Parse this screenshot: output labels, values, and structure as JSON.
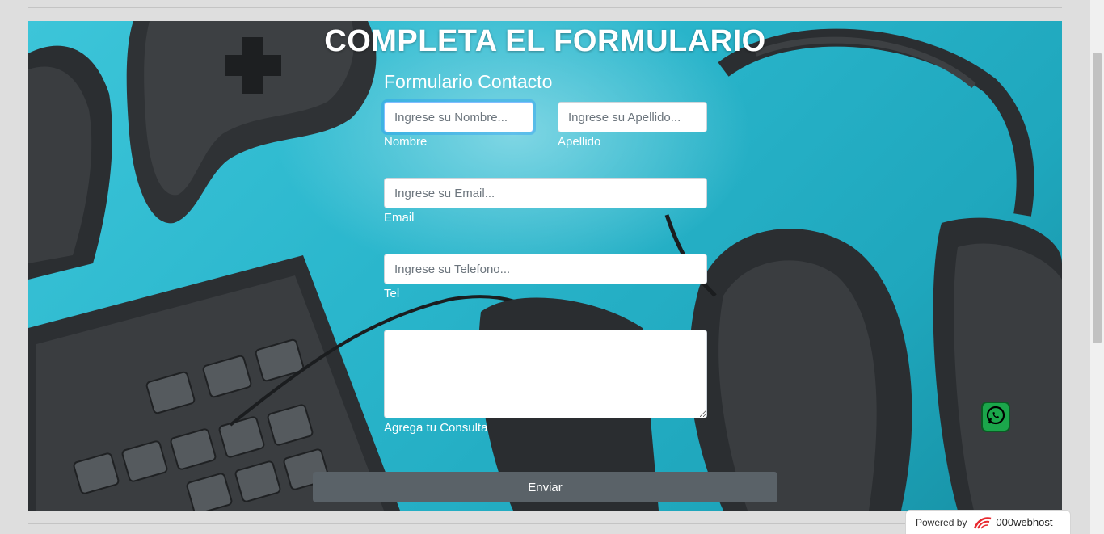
{
  "page": {
    "title": "COMPLETA EL FORMULARIO",
    "form_title": "Formulario Contacto"
  },
  "form": {
    "nombre": {
      "placeholder": "Ingrese su Nombre...",
      "label": "Nombre"
    },
    "apellido": {
      "placeholder": "Ingrese su Apellido...",
      "label": "Apellido"
    },
    "email": {
      "placeholder": "Ingrese su Email...",
      "label": "Email"
    },
    "tel": {
      "placeholder": "Ingrese su Telefono...",
      "label": "Tel"
    },
    "consulta": {
      "label": "Agrega tu Consulta"
    },
    "submit_label": "Enviar"
  },
  "footer": {
    "powered_by": "Powered by",
    "brand": "000webhost"
  },
  "icons": {
    "whatsapp": "whatsapp-icon",
    "webhost_logo": "000webhost-logo-icon"
  },
  "colors": {
    "accent_cyan": "#2ab6cc",
    "button_gray": "#5a6268",
    "whatsapp_green": "#1ba64b"
  }
}
